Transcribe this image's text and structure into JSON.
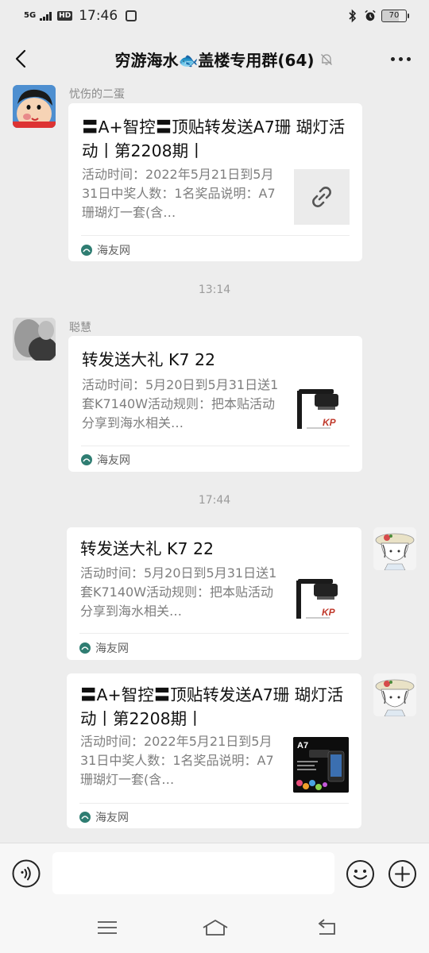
{
  "status_bar": {
    "network": "5G",
    "hd_label": "HD",
    "time": "17:46",
    "battery": "70"
  },
  "header": {
    "title": "穷游海水🐟盖楼专用群(64)",
    "icons": [
      "back-arrow-icon",
      "mute-bell-icon",
      "more-icon"
    ]
  },
  "messages": [
    {
      "sender": "忧伤的二蛋",
      "title": "〓A+智控〓顶贴转发送A7珊 瑚灯活动丨第2208期丨",
      "description": "活动时间：2022年5月21日到5月31日中奖人数：1名奖品说明：A7珊瑚灯一套(含…",
      "thumb": "link-icon",
      "source": "海友网"
    },
    {
      "sender": "聪慧",
      "title": "转发送大礼 K7 22",
      "description": "活动时间：5月20日到5月31日送1套K7140W活动规则：把本贴活动分享到海水相关…",
      "thumb": "lamp-product-image",
      "source": "海友网"
    },
    {
      "sender": "",
      "title": "转发送大礼 K7 22",
      "description": "活动时间：5月20日到5月31日送1套K7140W活动规则：把本贴活动分享到海水相关…",
      "thumb": "lamp-product-image",
      "source": "海友网"
    },
    {
      "sender": "",
      "title": "〓A+智控〓顶贴转发送A7珊 瑚灯活动丨第2208期丨",
      "description": "活动时间：2022年5月21日到5月31日中奖人数：1名奖品说明：A7珊瑚灯一套(含…",
      "thumb": "a7-product-image",
      "source": "海友网"
    }
  ],
  "timestamps": [
    "13:14",
    "17:44"
  ],
  "input": {
    "placeholder": ""
  },
  "colors": {
    "background": "#ededed",
    "card": "#ffffff",
    "source_icon": "#2f7d72"
  }
}
